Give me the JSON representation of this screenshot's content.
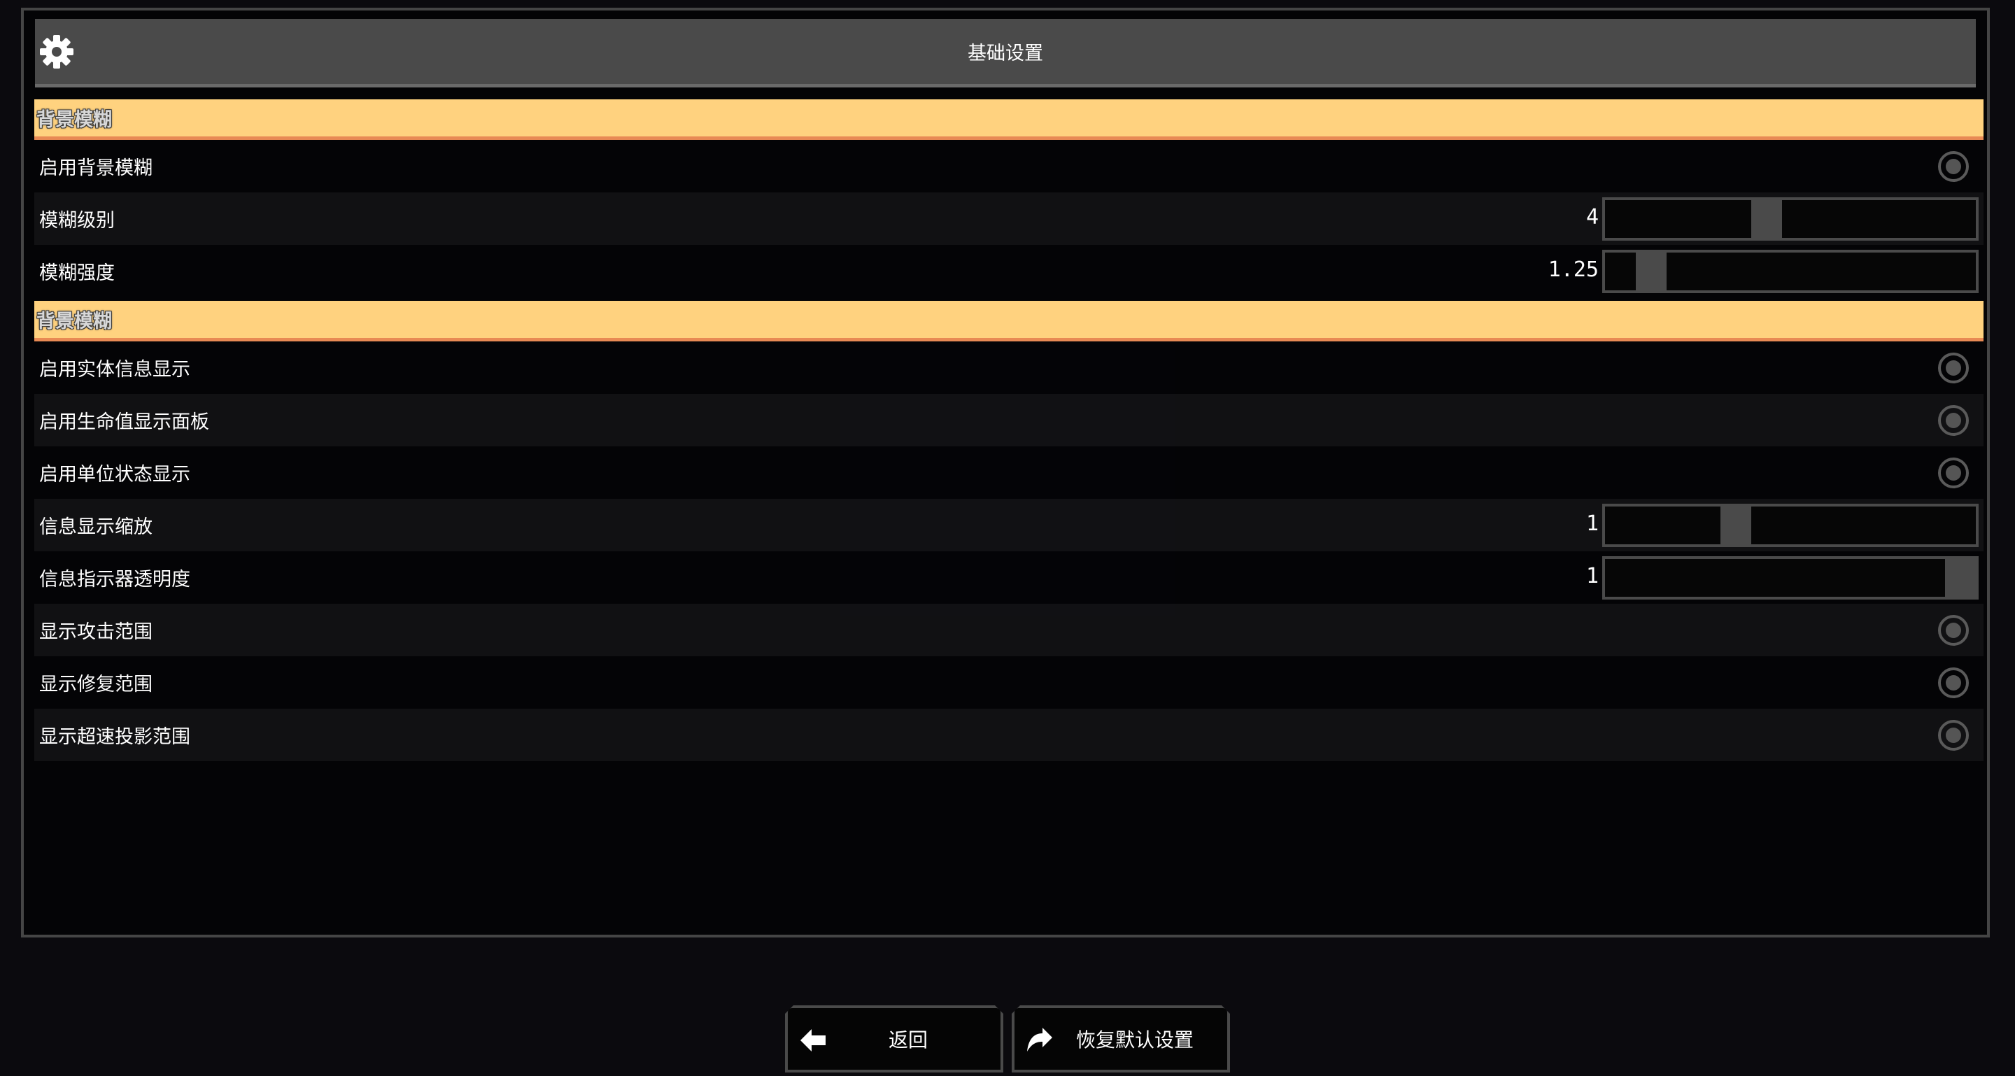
{
  "header": {
    "title": "基础设置",
    "icon": "gear-icon"
  },
  "sections": [
    {
      "title": "背景模糊",
      "rows": [
        {
          "type": "toggle",
          "label": "启用背景模糊",
          "enabled": false
        },
        {
          "type": "slider",
          "label": "模糊级别",
          "value": "4",
          "fraction": 0.43
        },
        {
          "type": "slider",
          "label": "模糊强度",
          "value": "1.25",
          "fraction": 0.09
        }
      ]
    },
    {
      "title": "背景模糊",
      "rows": [
        {
          "type": "toggle",
          "label": "启用实体信息显示",
          "enabled": false
        },
        {
          "type": "toggle",
          "label": "启用生命值显示面板",
          "enabled": false
        },
        {
          "type": "toggle",
          "label": "启用单位状态显示",
          "enabled": false
        },
        {
          "type": "slider",
          "label": "信息显示缩放",
          "value": "1",
          "fraction": 0.34
        },
        {
          "type": "slider",
          "label": "信息指示器透明度",
          "value": "1",
          "fraction": 1.0
        },
        {
          "type": "toggle",
          "label": "显示攻击范围",
          "enabled": false
        },
        {
          "type": "toggle",
          "label": "显示修复范围",
          "enabled": false
        },
        {
          "type": "toggle",
          "label": "显示超速投影范围",
          "enabled": false
        }
      ]
    }
  ],
  "buttons": {
    "back": {
      "label": "返回",
      "icon": "arrow-left-icon"
    },
    "reset": {
      "label": "恢复默认设置",
      "icon": "share-arrow-icon"
    }
  },
  "colors": {
    "accent": "#ffd27f",
    "accent_border": "#e88a54",
    "panel_border": "#454545",
    "header_bg": "#4a4a4a"
  }
}
